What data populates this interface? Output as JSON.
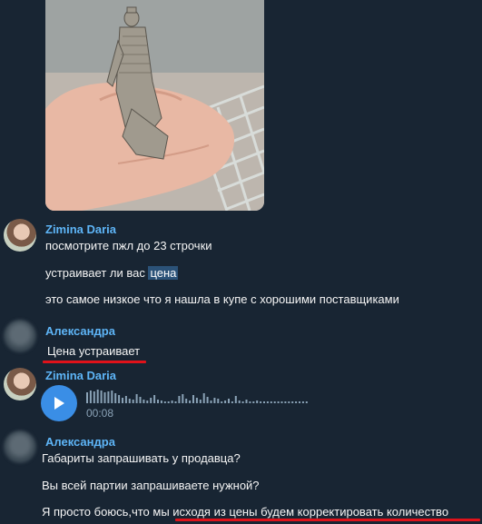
{
  "image_message": {
    "alt": ""
  },
  "messages": [
    {
      "author": "Zimina Daria",
      "lines": [
        "посмотрите пжл до 23 строчки"
      ]
    },
    {
      "text_before": "устраивает ли вас ",
      "highlight": "цена"
    },
    {
      "text": "это самое низкое что я нашла в купе с хорошими поставщиками"
    },
    {
      "author": "Александра",
      "text": "Цена устраивает"
    },
    {
      "author": "Zimina Daria",
      "voice_duration": "00:08"
    },
    {
      "author": "Александра",
      "lines": [
        "Габариты запрашивать у продавца?",
        "Вы всей партии запрашиваете нужной?",
        "Я просто боюсь,что мы исходя из цены будем корректировать количество"
      ]
    }
  ],
  "colors": {
    "background": "#182533",
    "name": "#5eb5f7",
    "accent": "#3a8ee6",
    "underline": "#e0121a"
  }
}
